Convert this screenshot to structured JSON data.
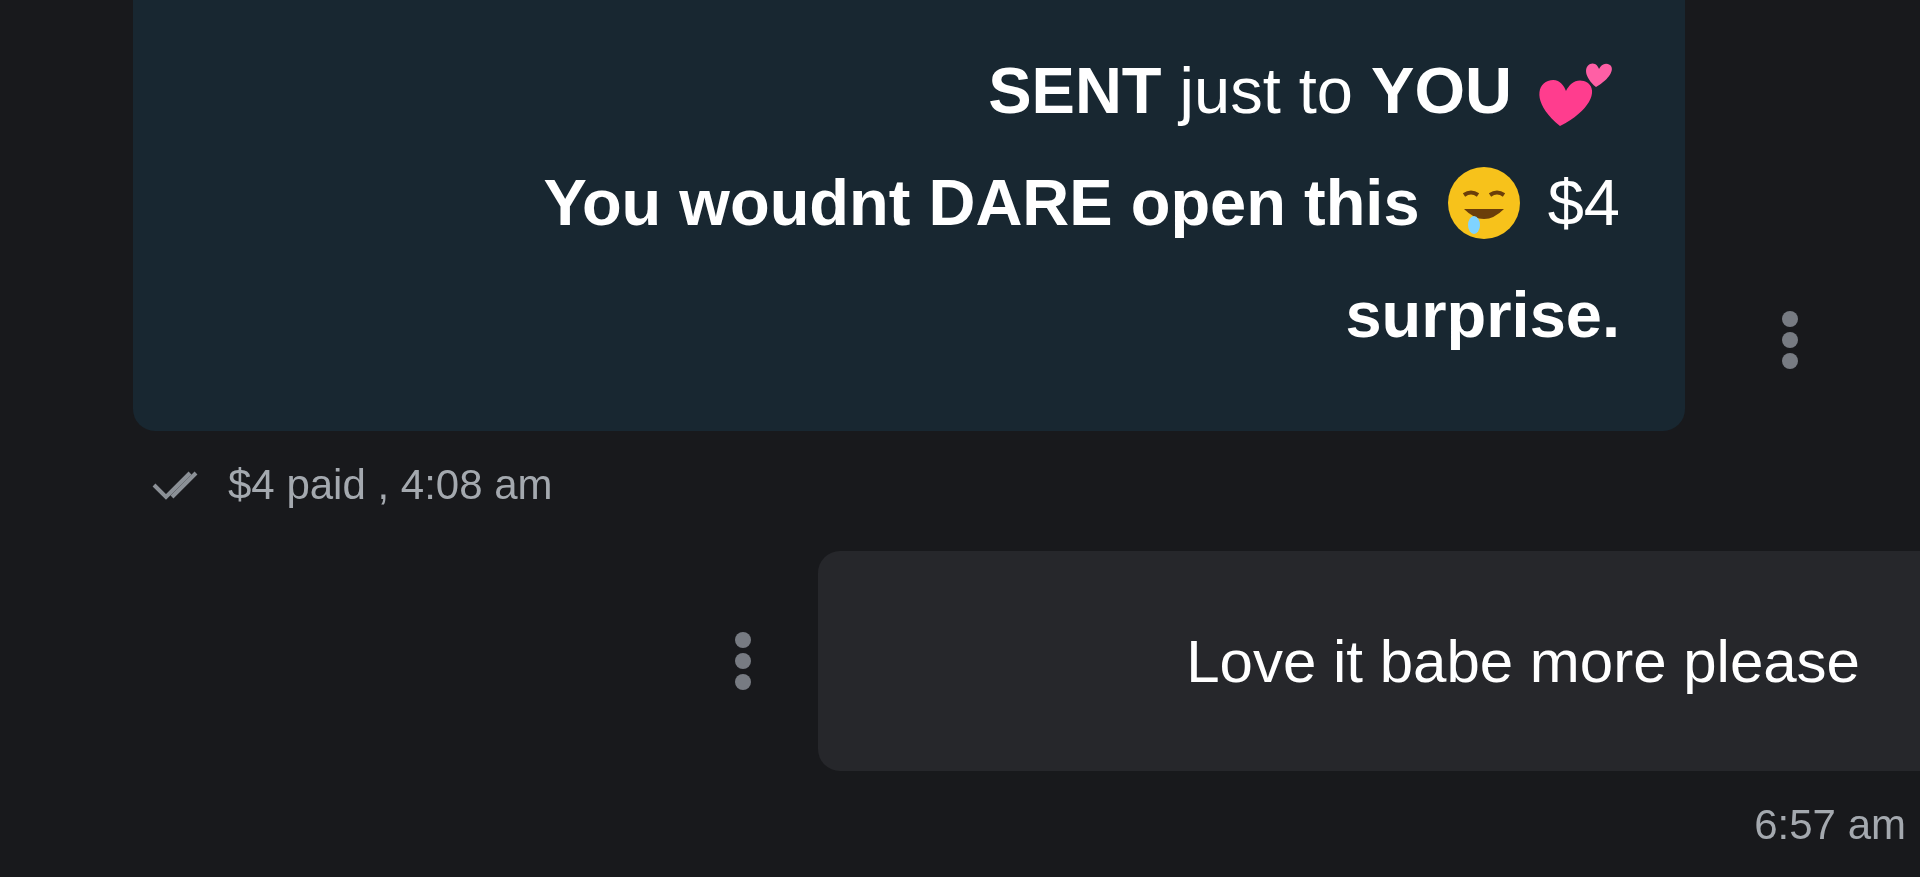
{
  "messages": [
    {
      "kind": "received",
      "lines": [
        [
          {
            "kind": "text",
            "text": "**SENT** just to **YOU** "
          },
          {
            "kind": "hearts"
          }
        ],
        [
          {
            "kind": "text",
            "text": "**You woudnt DARE open this** "
          },
          {
            "kind": "smiley"
          },
          {
            "kind": "text",
            "text": " $4"
          }
        ],
        [
          {
            "kind": "text",
            "text": "**surprise.**"
          }
        ]
      ],
      "meta": "$4 paid , 4:08 am",
      "read": true
    },
    {
      "kind": "sent",
      "lines": [
        [
          {
            "kind": "text",
            "text": "Love it babe more please"
          }
        ]
      ],
      "meta": "6:57 am"
    }
  ]
}
